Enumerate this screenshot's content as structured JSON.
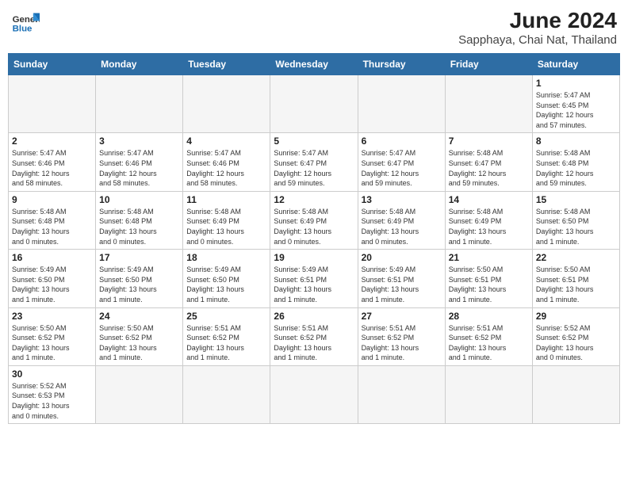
{
  "logo": {
    "text_general": "General",
    "text_blue": "Blue"
  },
  "title": "June 2024",
  "subtitle": "Sapphaya, Chai Nat, Thailand",
  "days_of_week": [
    "Sunday",
    "Monday",
    "Tuesday",
    "Wednesday",
    "Thursday",
    "Friday",
    "Saturday"
  ],
  "weeks": [
    [
      {
        "day": "",
        "info": ""
      },
      {
        "day": "",
        "info": ""
      },
      {
        "day": "",
        "info": ""
      },
      {
        "day": "",
        "info": ""
      },
      {
        "day": "",
        "info": ""
      },
      {
        "day": "",
        "info": ""
      },
      {
        "day": "1",
        "info": "Sunrise: 5:47 AM\nSunset: 6:45 PM\nDaylight: 12 hours\nand 57 minutes."
      }
    ],
    [
      {
        "day": "2",
        "info": "Sunrise: 5:47 AM\nSunset: 6:46 PM\nDaylight: 12 hours\nand 58 minutes."
      },
      {
        "day": "3",
        "info": "Sunrise: 5:47 AM\nSunset: 6:46 PM\nDaylight: 12 hours\nand 58 minutes."
      },
      {
        "day": "4",
        "info": "Sunrise: 5:47 AM\nSunset: 6:46 PM\nDaylight: 12 hours\nand 58 minutes."
      },
      {
        "day": "5",
        "info": "Sunrise: 5:47 AM\nSunset: 6:47 PM\nDaylight: 12 hours\nand 59 minutes."
      },
      {
        "day": "6",
        "info": "Sunrise: 5:47 AM\nSunset: 6:47 PM\nDaylight: 12 hours\nand 59 minutes."
      },
      {
        "day": "7",
        "info": "Sunrise: 5:48 AM\nSunset: 6:47 PM\nDaylight: 12 hours\nand 59 minutes."
      },
      {
        "day": "8",
        "info": "Sunrise: 5:48 AM\nSunset: 6:48 PM\nDaylight: 12 hours\nand 59 minutes."
      }
    ],
    [
      {
        "day": "9",
        "info": "Sunrise: 5:48 AM\nSunset: 6:48 PM\nDaylight: 13 hours\nand 0 minutes."
      },
      {
        "day": "10",
        "info": "Sunrise: 5:48 AM\nSunset: 6:48 PM\nDaylight: 13 hours\nand 0 minutes."
      },
      {
        "day": "11",
        "info": "Sunrise: 5:48 AM\nSunset: 6:49 PM\nDaylight: 13 hours\nand 0 minutes."
      },
      {
        "day": "12",
        "info": "Sunrise: 5:48 AM\nSunset: 6:49 PM\nDaylight: 13 hours\nand 0 minutes."
      },
      {
        "day": "13",
        "info": "Sunrise: 5:48 AM\nSunset: 6:49 PM\nDaylight: 13 hours\nand 0 minutes."
      },
      {
        "day": "14",
        "info": "Sunrise: 5:48 AM\nSunset: 6:49 PM\nDaylight: 13 hours\nand 1 minute."
      },
      {
        "day": "15",
        "info": "Sunrise: 5:48 AM\nSunset: 6:50 PM\nDaylight: 13 hours\nand 1 minute."
      }
    ],
    [
      {
        "day": "16",
        "info": "Sunrise: 5:49 AM\nSunset: 6:50 PM\nDaylight: 13 hours\nand 1 minute."
      },
      {
        "day": "17",
        "info": "Sunrise: 5:49 AM\nSunset: 6:50 PM\nDaylight: 13 hours\nand 1 minute."
      },
      {
        "day": "18",
        "info": "Sunrise: 5:49 AM\nSunset: 6:50 PM\nDaylight: 13 hours\nand 1 minute."
      },
      {
        "day": "19",
        "info": "Sunrise: 5:49 AM\nSunset: 6:51 PM\nDaylight: 13 hours\nand 1 minute."
      },
      {
        "day": "20",
        "info": "Sunrise: 5:49 AM\nSunset: 6:51 PM\nDaylight: 13 hours\nand 1 minute."
      },
      {
        "day": "21",
        "info": "Sunrise: 5:50 AM\nSunset: 6:51 PM\nDaylight: 13 hours\nand 1 minute."
      },
      {
        "day": "22",
        "info": "Sunrise: 5:50 AM\nSunset: 6:51 PM\nDaylight: 13 hours\nand 1 minute."
      }
    ],
    [
      {
        "day": "23",
        "info": "Sunrise: 5:50 AM\nSunset: 6:52 PM\nDaylight: 13 hours\nand 1 minute."
      },
      {
        "day": "24",
        "info": "Sunrise: 5:50 AM\nSunset: 6:52 PM\nDaylight: 13 hours\nand 1 minute."
      },
      {
        "day": "25",
        "info": "Sunrise: 5:51 AM\nSunset: 6:52 PM\nDaylight: 13 hours\nand 1 minute."
      },
      {
        "day": "26",
        "info": "Sunrise: 5:51 AM\nSunset: 6:52 PM\nDaylight: 13 hours\nand 1 minute."
      },
      {
        "day": "27",
        "info": "Sunrise: 5:51 AM\nSunset: 6:52 PM\nDaylight: 13 hours\nand 1 minute."
      },
      {
        "day": "28",
        "info": "Sunrise: 5:51 AM\nSunset: 6:52 PM\nDaylight: 13 hours\nand 1 minute."
      },
      {
        "day": "29",
        "info": "Sunrise: 5:52 AM\nSunset: 6:52 PM\nDaylight: 13 hours\nand 0 minutes."
      }
    ],
    [
      {
        "day": "30",
        "info": "Sunrise: 5:52 AM\nSunset: 6:53 PM\nDaylight: 13 hours\nand 0 minutes."
      },
      {
        "day": "",
        "info": ""
      },
      {
        "day": "",
        "info": ""
      },
      {
        "day": "",
        "info": ""
      },
      {
        "day": "",
        "info": ""
      },
      {
        "day": "",
        "info": ""
      },
      {
        "day": "",
        "info": ""
      }
    ]
  ]
}
